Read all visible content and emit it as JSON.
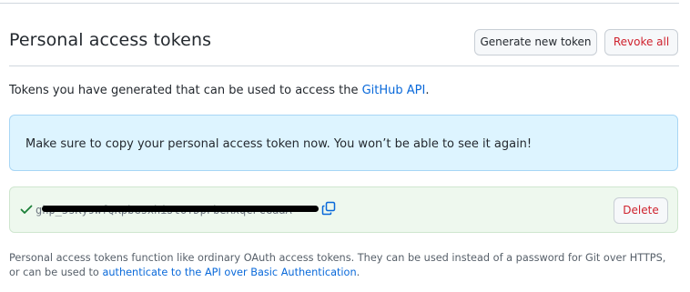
{
  "header": {
    "title": "Personal access tokens",
    "generate_label": "Generate new token",
    "revoke_label": "Revoke all"
  },
  "intro": {
    "text": "Tokens you have generated that can be used to access the ",
    "link_text": "GitHub API",
    "suffix": "."
  },
  "flash": {
    "message": "Make sure to copy your personal access token now. You won’t be able to see it again!"
  },
  "token": {
    "value": "ghp_5sKy9WfQKpbGsxhiJtoYDpFbeRxqCFCGaaA",
    "delete_label": "Delete",
    "icons": {
      "status": "check-icon",
      "copy": "copy-icon"
    }
  },
  "footer": {
    "text": "Personal access tokens function like ordinary OAuth access tokens. They can be used instead of a password for Git over HTTPS, or can be used to ",
    "link_text": "authenticate to the API over Basic Authentication",
    "suffix": "."
  },
  "colors": {
    "accent": "#0969da",
    "danger": "#cf222e",
    "success": "#1a7f37",
    "flash_bg": "#ddf4ff",
    "token_bg": "#eef8ee"
  }
}
